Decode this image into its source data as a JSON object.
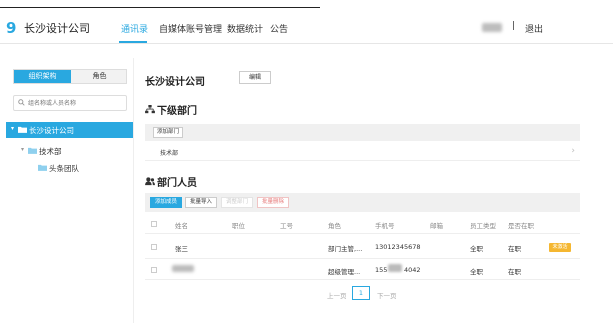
{
  "header": {
    "logo": "9",
    "company_name": "长沙设计公司",
    "nav": [
      "通讯录",
      "自媒体账号管理",
      "数据统计",
      "公告"
    ],
    "separator": "|",
    "logout": "退出"
  },
  "sidebar": {
    "tabs": [
      "组织架构",
      "角色"
    ],
    "search_placeholder": "组名称或人员名称",
    "tree": [
      {
        "label": "长沙设计公司"
      },
      {
        "label": "技术部"
      },
      {
        "label": "头条团队"
      }
    ]
  },
  "main": {
    "title": "长沙设计公司",
    "edit_button": "编辑",
    "sub_section": {
      "title": "下级部门",
      "add_button": "添加部门",
      "items": [
        "技术部"
      ]
    },
    "member_section": {
      "title": "部门人员",
      "buttons": [
        "添加成员",
        "批量导入",
        "调整部门",
        "批量删除"
      ],
      "columns": [
        "姓名",
        "职位",
        "工号",
        "角色",
        "手机号",
        "邮箱",
        "员工类型",
        "是否在职"
      ],
      "rows": [
        {
          "name": "张三",
          "position": "",
          "id": "",
          "role": "部门主管,...",
          "phone": "13012345678",
          "email": "",
          "type": "全职",
          "status": "在职",
          "badge": "未激活"
        },
        {
          "name": "",
          "position": "",
          "id": "",
          "role": "超级管理...",
          "phone_prefix": "155",
          "phone_suffix": "4042",
          "email": "",
          "type": "全职",
          "status": "在职"
        }
      ]
    },
    "pagination": {
      "prev": "上一页",
      "current": "1",
      "next": "下一页"
    }
  },
  "colors": {
    "accent": "#29a8e0",
    "badge": "#f5b731"
  }
}
